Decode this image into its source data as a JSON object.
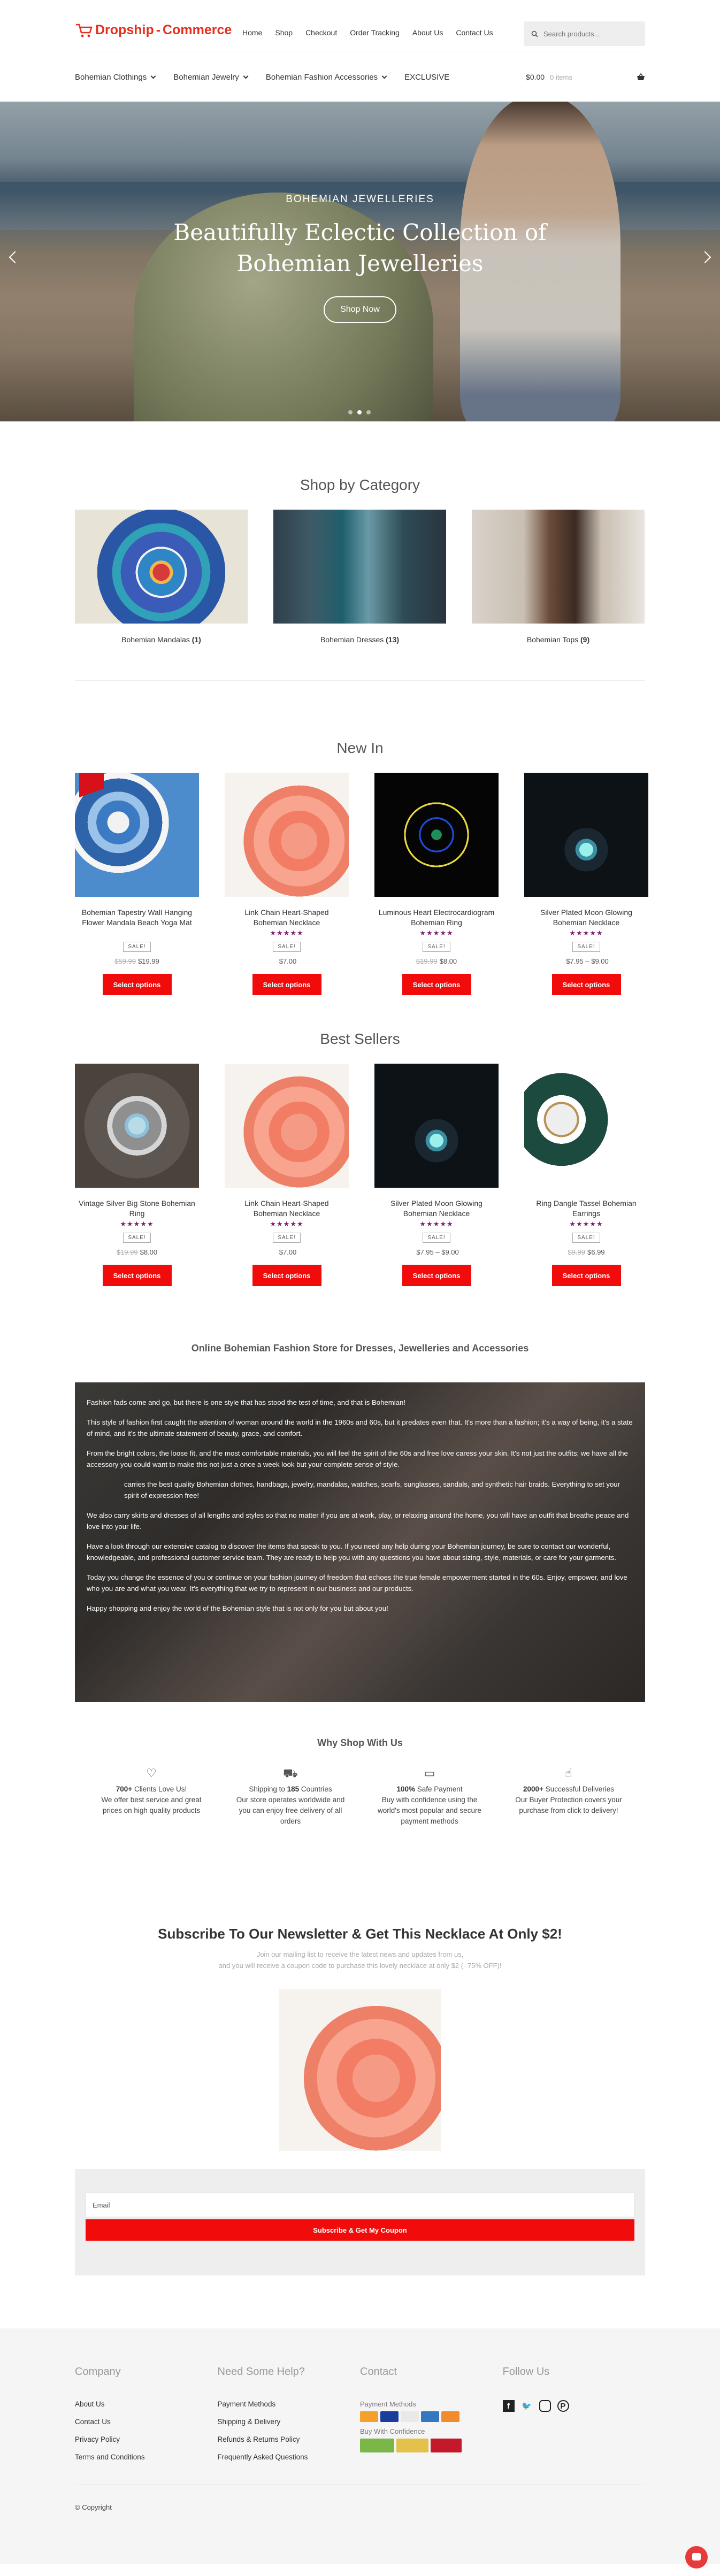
{
  "header": {
    "logo_part1": "Dropship",
    "logo_sep": "-",
    "logo_part2": "Commerce",
    "nav": [
      "Home",
      "Shop",
      "Checkout",
      "Order Tracking",
      "About Us",
      "Contact Us"
    ],
    "search_placeholder": "Search products..."
  },
  "catnav": {
    "items": [
      "Bohemian Clothings",
      "Bohemian Jewelry",
      "Bohemian Fashion Accessories",
      "EXCLUSIVE"
    ],
    "cart_total": "$0.00",
    "cart_items": "0 items"
  },
  "hero": {
    "subtitle": "BOHEMIAN JEWELLERIES",
    "title": "Beautifully Eclectic Collection of Bohemian Jewelleries",
    "button": "Shop Now"
  },
  "categories": {
    "title": "Shop by Category",
    "items": [
      {
        "name": "Bohemian Mandalas",
        "count": "(1)"
      },
      {
        "name": "Bohemian Dresses",
        "count": "(13)"
      },
      {
        "name": "Bohemian Tops",
        "count": "(9)"
      }
    ]
  },
  "new_in": {
    "title": "New In",
    "products": [
      {
        "name": "Bohemian Tapestry Wall Hanging Flower Mandala Beach Yoga Mat",
        "stars": "",
        "badge": "SALE!",
        "old": "$59.99",
        "price": "$19.99",
        "button": "Select options"
      },
      {
        "name": "Link Chain Heart-Shaped Bohemian Necklace",
        "stars": "★★★★★",
        "badge": "SALE!",
        "old": "",
        "price": "$7.00",
        "button": "Select options"
      },
      {
        "name": "Luminous Heart Electrocardiogram Bohemian Ring",
        "stars": "★★★★★",
        "badge": "SALE!",
        "old": "$19.99",
        "price": "$8.00",
        "button": "Select options"
      },
      {
        "name": "Silver Plated Moon Glowing Bohemian Necklace",
        "stars": "★★★★★",
        "badge": "SALE!",
        "old": "",
        "price": "$7.95 – $9.00",
        "button": "Select options"
      }
    ]
  },
  "best_sellers": {
    "title": "Best Sellers",
    "products": [
      {
        "name": "Vintage Silver Big Stone Bohemian Ring",
        "stars": "★★★★★",
        "badge": "SALE!",
        "old": "$19.99",
        "price": "$8.00",
        "button": "Select options"
      },
      {
        "name": "Link Chain Heart-Shaped Bohemian Necklace",
        "stars": "★★★★★",
        "badge": "SALE!",
        "old": "",
        "price": "$7.00",
        "button": "Select options"
      },
      {
        "name": "Silver Plated Moon Glowing Bohemian Necklace",
        "stars": "★★★★★",
        "badge": "SALE!",
        "old": "",
        "price": "$7.95 – $9.00",
        "button": "Select options"
      },
      {
        "name": "Ring Dangle Tassel Bohemian Earrings",
        "stars": "★★★★★",
        "badge": "SALE!",
        "old": "$9.99",
        "price": "$6.99",
        "button": "Select options"
      }
    ]
  },
  "about": {
    "title": "Online Bohemian Fashion Store for Dresses, Jewelleries and Accessories",
    "paragraphs": [
      "Fashion fads come and go, but there is one style that has stood the test of time, and that is Bohemian!",
      "This style of fashion first caught the attention of woman around the world in the 1960s and 60s, but it predates even that. It's more than a fashion; it's a way of being, it's a state of mind, and it's the ultimate statement of beauty, grace, and comfort.",
      "From the bright colors, the loose fit, and the most comfortable materials, you will feel the spirit of the 60s and free love caress your skin. It's not just the outfits; we have all the accessory you could want to make this not just a once a week look but your complete sense of style.",
      "carries the best quality Bohemian clothes, handbags, jewelry, mandalas, watches, scarfs, sunglasses, sandals, and synthetic hair braids. Everything to set your spirit of expression free!",
      "We also carry skirts and dresses of all lengths and styles so that no matter if you are at work, play, or relaxing around the home, you will have an outfit that breathe peace and love into your life.",
      "Have a look through our extensive catalog to discover the items that speak to you. If you need any help during your Bohemian journey, be sure to contact our wonderful, knowledgeable, and professional customer service team. They are ready to help you with any questions you have about sizing, style, materials, or care for your garments.",
      "Today you change the essence of you or continue on your fashion journey of freedom that echoes the true female empowerment started in the 60s. Enjoy, empower, and love who you are and what you wear. It's everything that we try to represent in our business and our products.",
      "Happy shopping and enjoy the world of the Bohemian style that is not only for you but about you!"
    ]
  },
  "why": {
    "title": "Why Shop With Us",
    "items": [
      {
        "icon": "heart-icon",
        "glyph": "♡",
        "bold": "700+",
        "rest": " Clients Love Us!",
        "text": "We offer best service and great prices on high quality products"
      },
      {
        "icon": "truck-icon",
        "glyph": "⛟",
        "pre": "Shipping to ",
        "bold": "185",
        "rest": " Countries",
        "text": "Our store operates worldwide and you can enjoy free delivery of all orders"
      },
      {
        "icon": "credit-card-icon",
        "glyph": "▭",
        "bold": "100%",
        "rest": " Safe Payment",
        "text": "Buy with confidence using the world's most popular and secure payment methods"
      },
      {
        "icon": "thumbs-up-icon",
        "glyph": "☝",
        "bold": "2000+",
        "rest": " Successful Deliveries",
        "text": "Our Buyer Protection covers your purchase from click to delivery!"
      }
    ]
  },
  "newsletter": {
    "title": "Subscribe To Our Newsletter & Get This Necklace At Only $2!",
    "line1": "Join our mailing list to receive the latest news and updates from us,",
    "line2": "and you will receive a coupon code to purchase this lovely necklace at only $2 (- 75% OFF)!",
    "email_placeholder": "Email",
    "button": "Subscribe & Get My Coupon"
  },
  "footer": {
    "company_title": "Company",
    "company_links": [
      "About Us",
      "Contact Us",
      "Privacy Policy",
      "Terms and Conditions"
    ],
    "help_title": "Need Some Help?",
    "help_links": [
      "Payment Methods",
      "Shipping & Delivery",
      "Refunds & Returns Policy",
      "Frequently Asked Questions"
    ],
    "contact_title": "Contact",
    "payment_label": "Payment Methods",
    "confidence_label": "Buy With Confidence",
    "follow_title": "Follow Us",
    "copyright": "© Copyright"
  },
  "colors": {
    "accent": "#f10b0b",
    "logo": "#e62e1b",
    "stars": "#7e1a6f"
  }
}
